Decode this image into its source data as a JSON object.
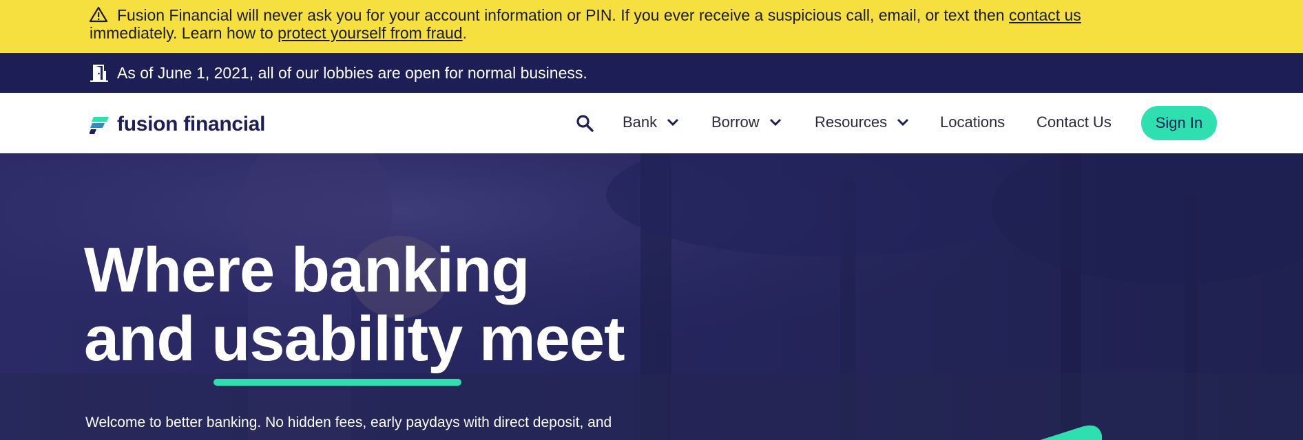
{
  "alert": {
    "icon": "warning-icon",
    "line1_text": "Fusion Financial will never ask you for your account information or PIN. If you ever receive a suspicious call, email, or text then ",
    "contact_link": "contact us",
    "line2_text": "immediately. Learn how to ",
    "fraud_link": "protect yourself from fraud",
    "line2_end": ".",
    "background": "#f5e03f"
  },
  "notice": {
    "icon": "door-icon",
    "text": "As of June 1, 2021, all of our lobbies are open for normal business.",
    "background": "#1d1e55"
  },
  "header": {
    "logo_text": "fusion financial",
    "nav": {
      "bank": "Bank",
      "borrow": "Borrow",
      "resources": "Resources",
      "locations": "Locations",
      "contact": "Contact Us"
    },
    "sign_in": "Sign In",
    "accent_color": "#2ee0b0"
  },
  "hero": {
    "title_line1": "Where banking",
    "title_line2a": "and ",
    "title_highlight": "usability",
    "title_line2b": " meet",
    "subtitle": "Welcome to better banking. No hidden fees, early paydays with direct deposit, and"
  }
}
